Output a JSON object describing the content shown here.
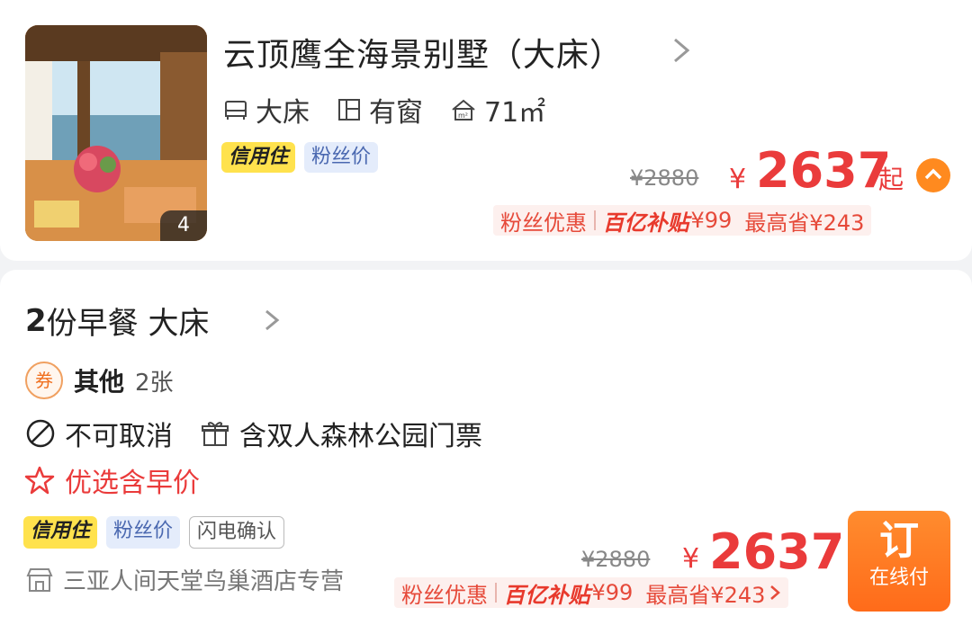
{
  "room": {
    "title": "云顶鹰全海景别墅（大床）",
    "photo_count": "4",
    "features": [
      {
        "icon": "bed-icon",
        "label": "大床"
      },
      {
        "icon": "window-icon",
        "label": "有窗"
      },
      {
        "icon": "area-icon",
        "label": "71㎡"
      }
    ],
    "tags": [
      "信用住",
      "粉丝价"
    ],
    "original_price": "¥2880",
    "currency": "¥",
    "price": "2637",
    "price_suffix": "起",
    "promo": {
      "fans": "粉丝优惠",
      "subsidy": "百亿补贴",
      "subsidy_amount": "¥99",
      "max_save": "最高省¥243"
    }
  },
  "plan": {
    "title_bold": "2",
    "title_rest": "份早餐 大床",
    "coupon_icon": "券",
    "coupon_label": "其他",
    "coupon_count": "2张",
    "cancel_policy": "不可取消",
    "gift": "含双人森林公园门票",
    "preference": "优选含早价",
    "tags": [
      "信用住",
      "粉丝价",
      "闪电确认"
    ],
    "store": "三亚人间天堂鸟巢酒店专营",
    "original_price": "¥2880",
    "currency": "¥",
    "price": "2637",
    "promo": {
      "fans": "粉丝优惠",
      "subsidy": "百亿补贴",
      "subsidy_amount": "¥99",
      "max_save": "最高省¥243"
    },
    "book_label": "订",
    "book_sub": "在线付"
  },
  "colors": {
    "price_red": "#ea3b3b",
    "accent_orange": "#ff7a22",
    "credit_yellow": "#ffe24d",
    "fans_blue_bg": "#e4ecfb"
  }
}
